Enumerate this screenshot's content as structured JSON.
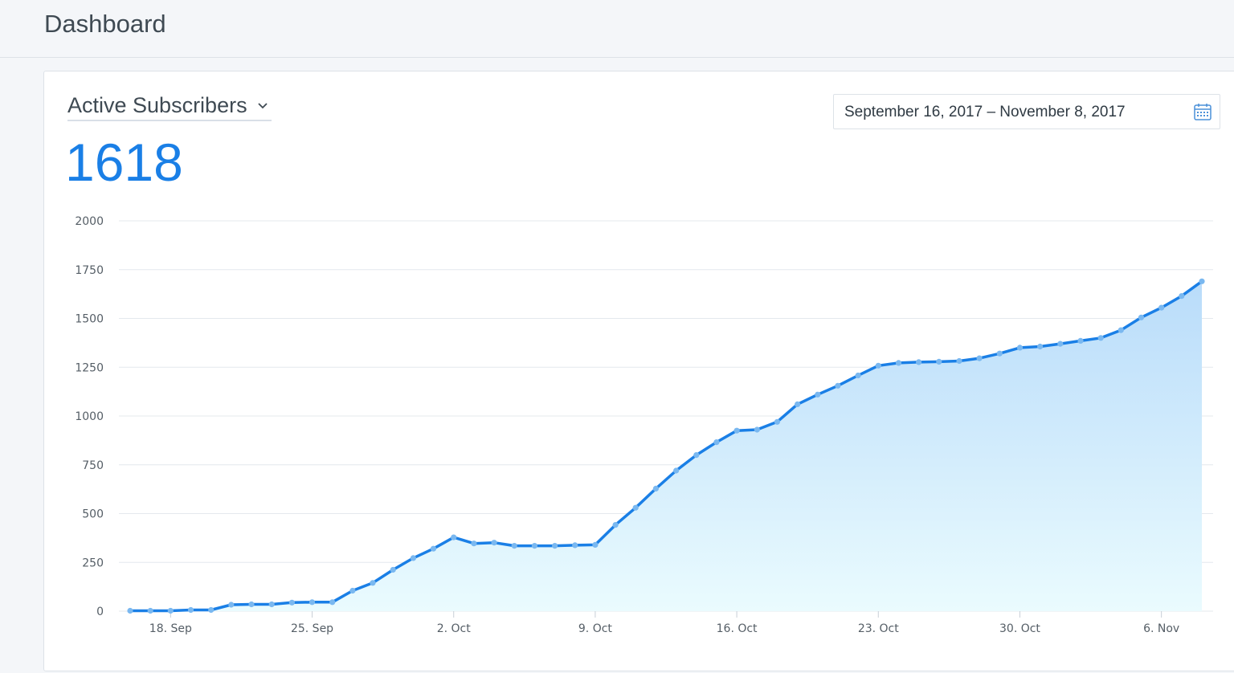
{
  "header": {
    "title": "Dashboard"
  },
  "card": {
    "metric_label": "Active Subscribers",
    "metric_icon": "chevron-down-icon",
    "metric_value": "1618",
    "date_range": "September 16, 2017 – November 8, 2017",
    "date_icon": "calendar-icon",
    "accent_color": "#1a7fe6"
  },
  "chart_data": {
    "type": "area",
    "x_start": "2017-09-16",
    "x_end": "2017-11-08",
    "x_tick_labels": [
      "18. Sep",
      "25. Sep",
      "2. Oct",
      "9. Oct",
      "16. Oct",
      "23. Oct",
      "30. Oct",
      "6. Nov"
    ],
    "x_tick_dates": [
      "2017-09-18",
      "2017-09-25",
      "2017-10-02",
      "2017-10-09",
      "2017-10-16",
      "2017-10-23",
      "2017-10-30",
      "2017-11-06"
    ],
    "y_ticks": [
      "0",
      "250",
      "500",
      "750",
      "1000",
      "1250",
      "1500",
      "1750",
      "2000"
    ],
    "ylim": [
      0,
      2000
    ],
    "grid": true,
    "series": [
      {
        "dates": [
          "2017-09-16",
          "2017-09-17",
          "2017-09-18",
          "2017-09-19",
          "2017-09-20",
          "2017-09-21",
          "2017-09-22",
          "2017-09-23",
          "2017-09-24",
          "2017-09-25",
          "2017-09-26",
          "2017-09-27",
          "2017-09-28",
          "2017-09-29",
          "2017-09-30",
          "2017-10-01",
          "2017-10-02",
          "2017-10-03",
          "2017-10-04",
          "2017-10-05",
          "2017-10-06",
          "2017-10-07",
          "2017-10-08",
          "2017-10-09",
          "2017-10-10",
          "2017-10-11",
          "2017-10-12",
          "2017-10-13",
          "2017-10-14",
          "2017-10-15",
          "2017-10-16",
          "2017-10-17",
          "2017-10-18",
          "2017-10-19",
          "2017-10-20",
          "2017-10-21",
          "2017-10-22",
          "2017-10-23",
          "2017-10-24",
          "2017-10-25",
          "2017-10-26",
          "2017-10-27",
          "2017-10-28",
          "2017-10-29",
          "2017-10-30",
          "2017-10-31",
          "2017-11-01",
          "2017-11-02",
          "2017-11-03",
          "2017-11-04",
          "2017-11-05",
          "2017-11-06",
          "2017-11-07",
          "2017-11-08"
        ],
        "values": [
          2,
          2,
          2,
          6,
          6,
          33,
          35,
          35,
          44,
          46,
          46,
          105,
          145,
          212,
          272,
          320,
          378,
          347,
          351,
          335,
          335,
          335,
          338,
          340,
          442,
          530,
          628,
          720,
          800,
          866,
          925,
          930,
          970,
          1060,
          1110,
          1155,
          1208,
          1258,
          1272,
          1276,
          1278,
          1282,
          1296,
          1320,
          1350,
          1356,
          1370,
          1385,
          1400,
          1440,
          1505,
          1555,
          1615,
          1690
        ]
      }
    ],
    "colors": {
      "line": "#1a7fe6",
      "marker": "#7ab8f0",
      "fill_top": "#b9dcfa",
      "fill_bottom": "#eafbfe",
      "grid": "#e4e8ee"
    }
  }
}
